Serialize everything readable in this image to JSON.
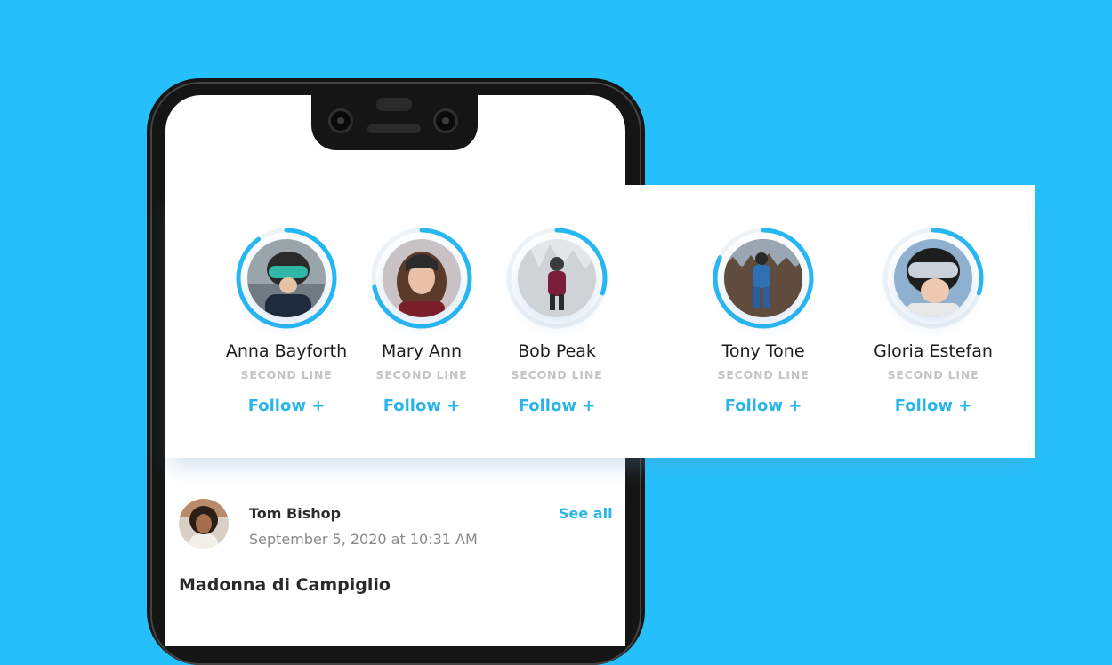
{
  "people": [
    {
      "name": "Anna Bayforth",
      "subtitle": "SECOND LINE",
      "follow_label": "Follow +",
      "avatar_icon": "skier-helmet-goggles-photo",
      "ring_progress": 0.9
    },
    {
      "name": "Mary Ann",
      "subtitle": "SECOND LINE",
      "follow_label": "Follow +",
      "avatar_icon": "woman-portrait-photo",
      "ring_progress": 0.72
    },
    {
      "name": "Bob Peak",
      "subtitle": "SECOND LINE",
      "follow_label": "Follow +",
      "avatar_icon": "skier-snow-photo",
      "ring_progress": 0.3
    },
    {
      "name": "Tony Tone",
      "subtitle": "SECOND LINE",
      "follow_label": "Follow +",
      "avatar_icon": "skier-forest-photo",
      "ring_progress": 0.82
    },
    {
      "name": "Gloria Estefan",
      "subtitle": "SECOND LINE",
      "follow_label": "Follow +",
      "avatar_icon": "skier-goggles-closeup-photo",
      "ring_progress": 0.3
    }
  ],
  "post": {
    "author": "Tom Bishop",
    "date": "September 5, 2020 at 10:31 AM",
    "see_all_label": "See all",
    "title": "Madonna di Campiglio",
    "author_avatar_icon": "man-curly-hair-photo"
  },
  "colors": {
    "background": "#25c0fb",
    "accent": "#29b5e8",
    "ring": "#27b8f2",
    "secondary_text": "#c4c4c4"
  }
}
